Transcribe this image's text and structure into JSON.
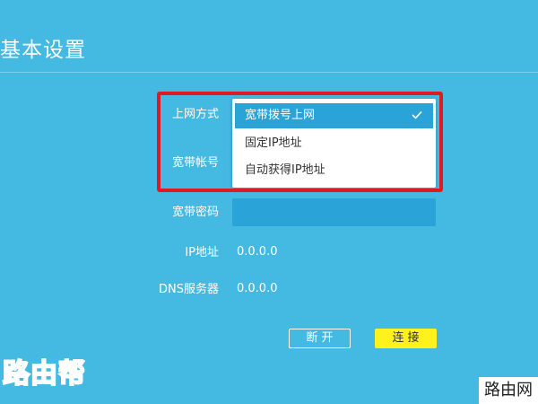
{
  "page": {
    "title": "基本设置"
  },
  "form": {
    "connection_type_label": "上网方式",
    "account_label": "宽带帐号",
    "password_label": "宽带密码",
    "ip_label": "IP地址",
    "ip_value": "0.0.0.0",
    "dns_label": "DNS服务器",
    "dns_value": "0.0.0.0"
  },
  "dropdown": {
    "selected": "宽带拨号上网",
    "options": [
      "宽带拨号上网",
      "固定IP地址",
      "自动获得IP地址"
    ],
    "selected_icon": "check-icon"
  },
  "buttons": {
    "disconnect_label": "断开",
    "connect_label": "连接"
  },
  "watermarks": {
    "left_logo": "路由帮",
    "right_badge": "路由网"
  },
  "colors": {
    "background": "#44b9e2",
    "field": "#2aa3d8",
    "highlight": "#e01a22",
    "connect_button": "#fff21c"
  }
}
